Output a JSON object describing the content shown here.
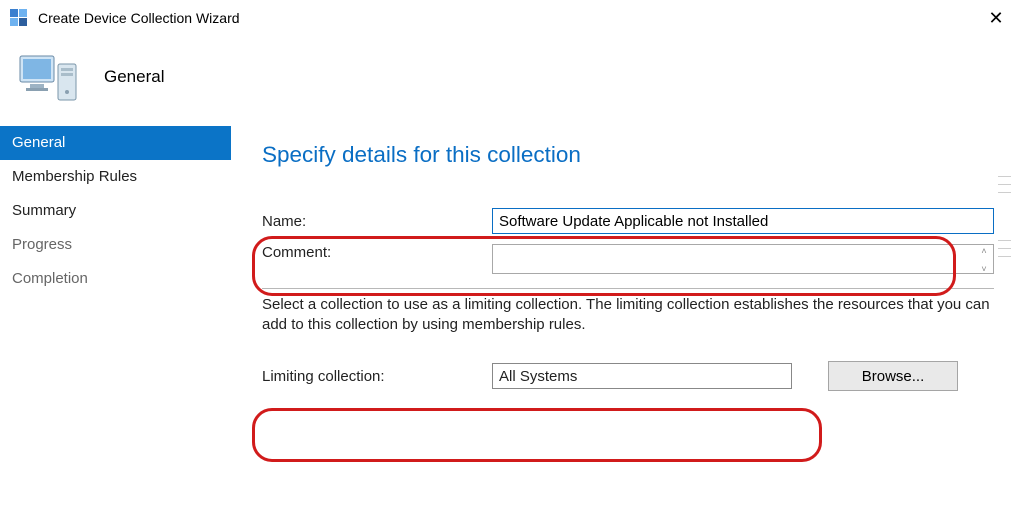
{
  "window": {
    "title": "Create Device Collection Wizard",
    "close_glyph": "✕"
  },
  "header": {
    "page_name": "General"
  },
  "sidebar": {
    "steps": [
      {
        "label": "General",
        "state": "active"
      },
      {
        "label": "Membership Rules",
        "state": "normal"
      },
      {
        "label": "Summary",
        "state": "normal"
      },
      {
        "label": "Progress",
        "state": "minor"
      },
      {
        "label": "Completion",
        "state": "minor"
      }
    ]
  },
  "main": {
    "heading": "Specify details for this collection",
    "name_label": "Name:",
    "name_value": "Software Update Applicable not Installed",
    "comment_label": "Comment:",
    "comment_value": "",
    "help_text": "Select a collection to use as a limiting collection. The limiting collection establishes the resources that you can add to this collection by using membership rules.",
    "limiting_label": "Limiting collection:",
    "limiting_value": "All Systems",
    "browse_label": "Browse..."
  }
}
